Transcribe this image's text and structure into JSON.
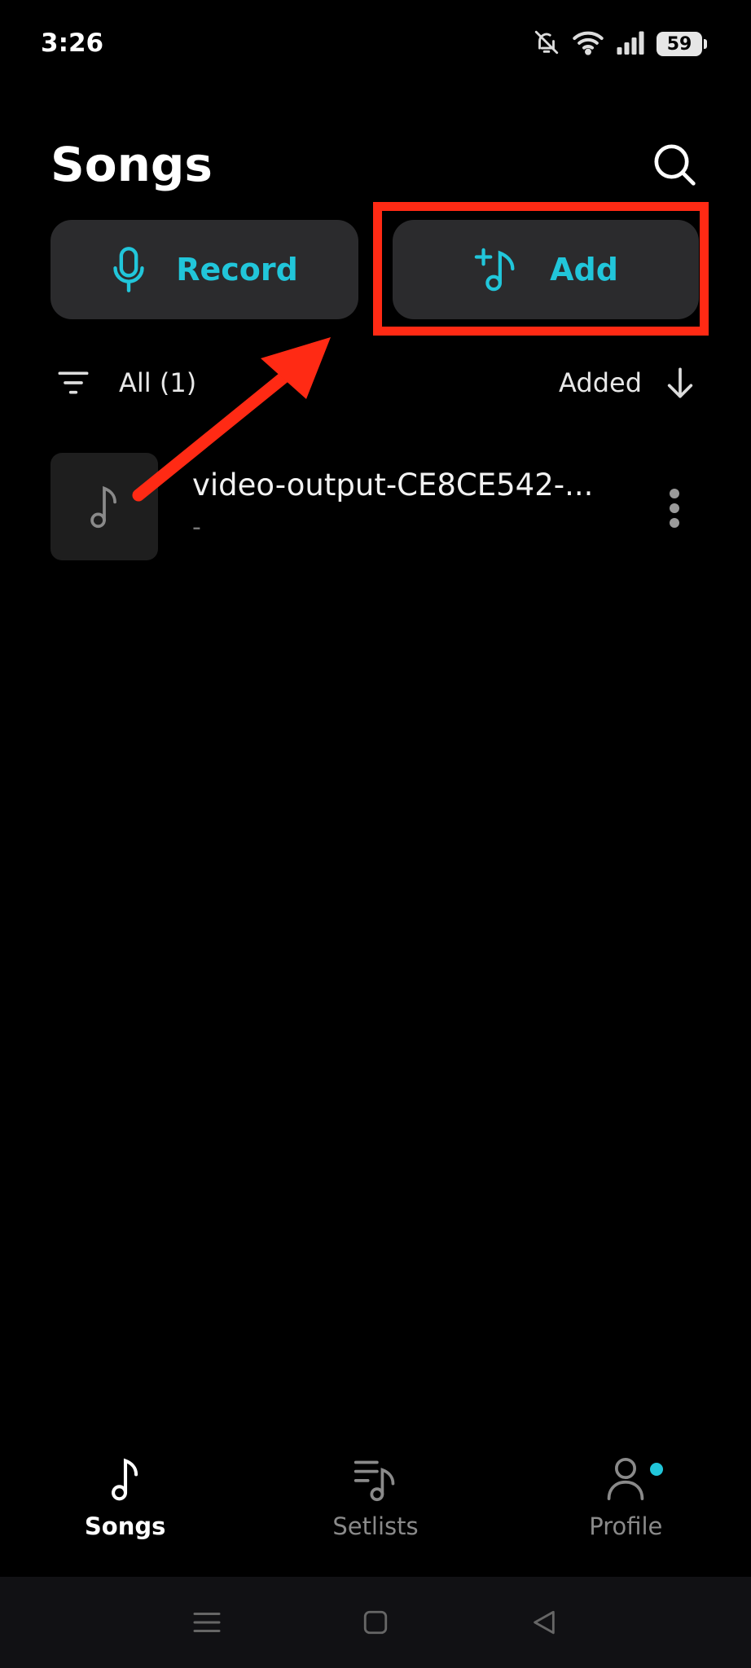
{
  "status_bar": {
    "time": "3:26",
    "battery": "59",
    "icons": [
      "bell-off-icon",
      "wifi-icon",
      "signal-icon",
      "battery-icon"
    ]
  },
  "header": {
    "title": "Songs",
    "search_icon": "search-icon"
  },
  "actions": {
    "record_label": "Record",
    "record_icon": "microphone-icon",
    "add_label": "Add",
    "add_icon": "add-music-icon"
  },
  "filter": {
    "label": "All (1)",
    "icon": "filter-icon"
  },
  "sort": {
    "label": "Added",
    "icon": "arrow-down-icon"
  },
  "songs": [
    {
      "title": "video-output-CE8CE542-...",
      "subtitle": "-",
      "icon": "music-note-icon"
    }
  ],
  "bottom_nav": {
    "items": [
      {
        "label": "Songs",
        "icon": "music-note-icon",
        "active": true
      },
      {
        "label": "Setlists",
        "icon": "setlist-icon",
        "active": false
      },
      {
        "label": "Profile",
        "icon": "person-icon",
        "active": false,
        "badge": true
      }
    ]
  },
  "system_nav": [
    "menu-icon",
    "home-icon",
    "back-icon"
  ],
  "colors": {
    "accent": "#21c6da",
    "highlight": "#ff2a14",
    "button_bg": "#2b2b2d",
    "background": "#000000"
  }
}
